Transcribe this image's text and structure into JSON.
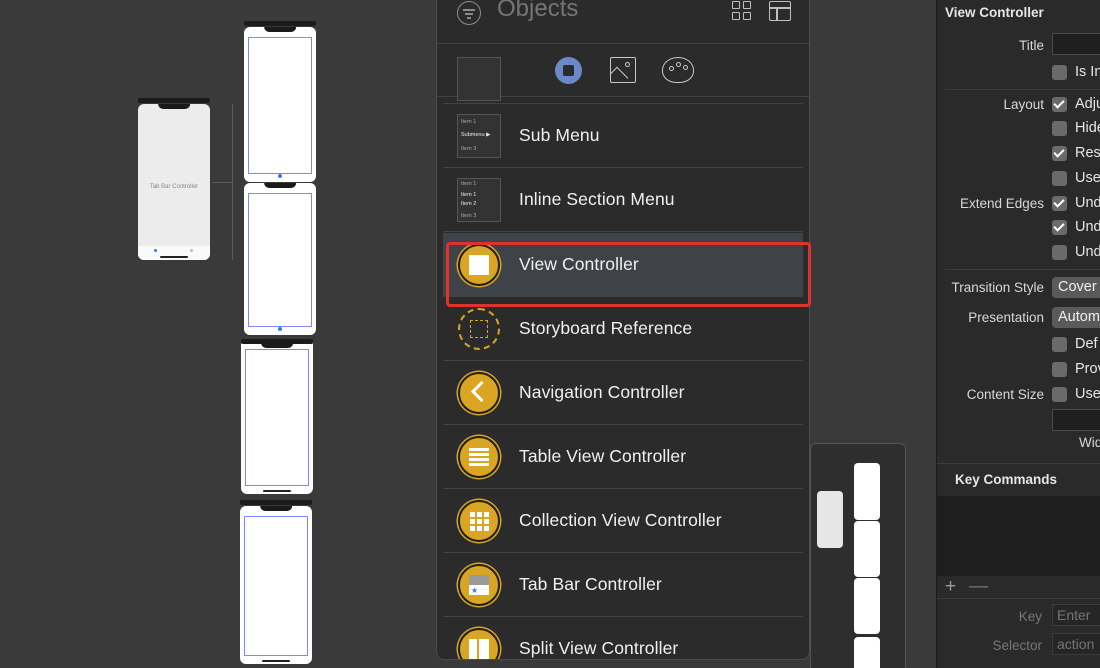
{
  "canvas": {
    "tab_bar_controller_label": "Tab Bar Controller"
  },
  "library": {
    "search_placeholder": "Objects",
    "tabs": [
      "objects",
      "media",
      "colors"
    ],
    "items": [
      {
        "label": "Sub Menu",
        "icon": "submenu-thumbnail"
      },
      {
        "label": "Inline Section Menu",
        "icon": "inline-section-thumbnail"
      },
      {
        "label": "View Controller",
        "icon": "view-controller-icon",
        "selected": true
      },
      {
        "label": "Storyboard Reference",
        "icon": "storyboard-reference-icon"
      },
      {
        "label": "Navigation Controller",
        "icon": "navigation-controller-icon"
      },
      {
        "label": "Table View Controller",
        "icon": "table-view-controller-icon"
      },
      {
        "label": "Collection View Controller",
        "icon": "collection-view-controller-icon"
      },
      {
        "label": "Tab Bar Controller",
        "icon": "tab-bar-controller-icon"
      },
      {
        "label": "Split View Controller",
        "icon": "split-view-controller-icon"
      }
    ],
    "submenu_thumb": {
      "line1": "Item 1",
      "line2": "Submenu ▶",
      "line3": "Item 3"
    },
    "inline_thumb": {
      "line1": "Item 1",
      "line2": "Item 1",
      "line3": "Item 2",
      "line4": "Item 3"
    },
    "accent_color": "#d9a522",
    "highlight_color": "#e0322c"
  },
  "inspector": {
    "section_title": "View Controller",
    "title_label": "Title",
    "title_value": "",
    "is_initial": {
      "label": "Is In",
      "checked": false
    },
    "layout_label": "Layout",
    "layout_options": [
      {
        "label": "Adju",
        "checked": true
      },
      {
        "label": "Hide",
        "checked": false
      },
      {
        "label": "Res",
        "checked": true
      },
      {
        "label": "Use",
        "checked": false
      }
    ],
    "extend_edges_label": "Extend Edges",
    "extend_edges_options": [
      {
        "label": "Und",
        "checked": true
      },
      {
        "label": "Und",
        "checked": true
      },
      {
        "label": "Und",
        "checked": false
      }
    ],
    "transition_style_label": "Transition Style",
    "transition_style_value": "Cover",
    "presentation_label": "Presentation",
    "presentation_value": "Autom",
    "presentation_options": [
      {
        "label": "Def",
        "checked": false
      },
      {
        "label": "Prov",
        "checked": false
      }
    ],
    "content_size_label": "Content Size",
    "content_size_option": {
      "label": "Use",
      "checked": false
    },
    "width_label": "Wid",
    "key_commands_title": "Key Commands",
    "add_symbol": "+",
    "remove_symbol": "—",
    "key_label": "Key",
    "key_placeholder": "Enter",
    "selector_label": "Selector",
    "selector_placeholder": "action"
  }
}
